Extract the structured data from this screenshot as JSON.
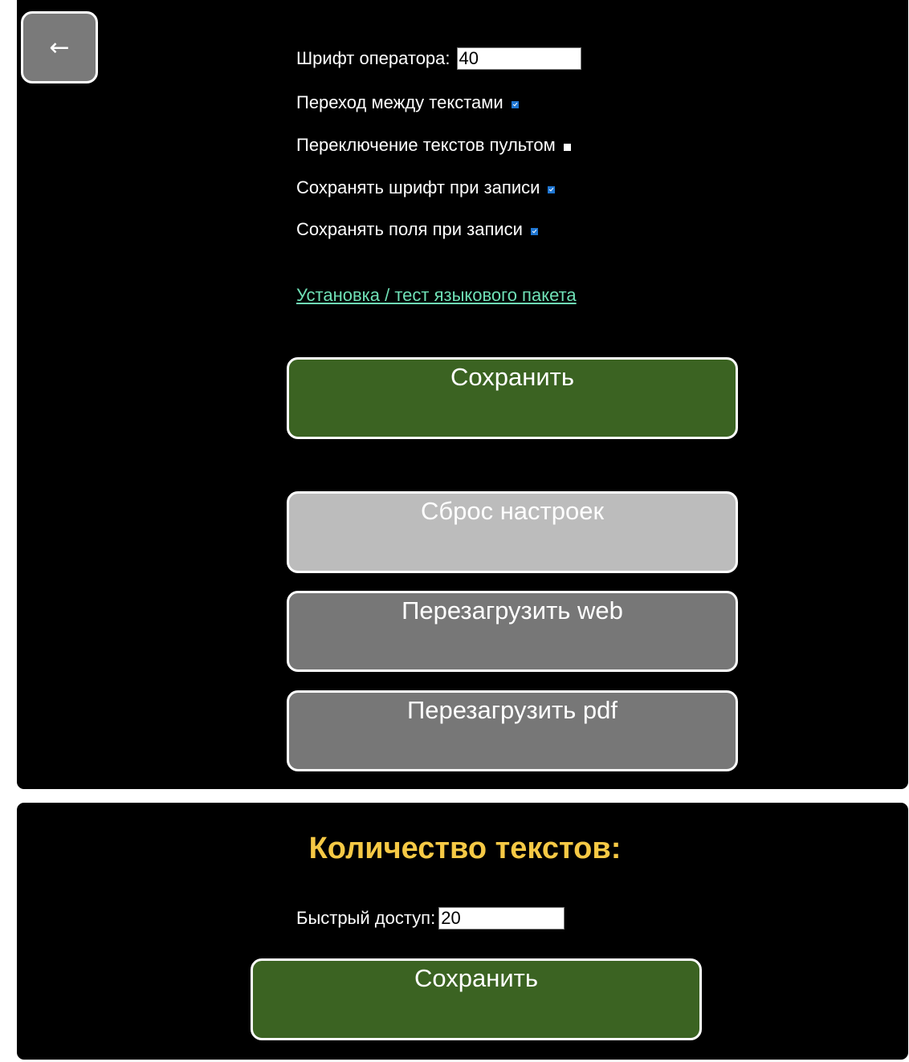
{
  "back_button": {
    "label": "←"
  },
  "settings": {
    "operator_font": {
      "label": "Шрифт оператора:",
      "value": "40"
    },
    "toggles": [
      {
        "label": "Переход между текстами",
        "checked": true
      },
      {
        "label": "Переключение текстов пультом",
        "checked": false
      },
      {
        "label": "Сохранять шрифт при записи",
        "checked": true
      },
      {
        "label": "Сохранять поля при записи",
        "checked": true
      }
    ],
    "language_pack_link": "Установка / тест языкового пакета",
    "save_label": "Сохранить",
    "reset_label": "Сброс настроек",
    "reload_web_label": "Перезагрузить web",
    "reload_pdf_label": "Перезагрузить pdf"
  },
  "text_count": {
    "heading": "Количество текстов:",
    "quick_access": {
      "label": "Быстрый доступ:",
      "value": "20"
    },
    "save_label": "Сохранить"
  },
  "colors": {
    "background": "#000000",
    "save_button": "#3b6322",
    "reset_button": "#bcbcbc",
    "reload_button": "#777777",
    "heading": "#f6c945",
    "link": "#6fe0b6",
    "checkbox_checked": "#1f76d2"
  }
}
